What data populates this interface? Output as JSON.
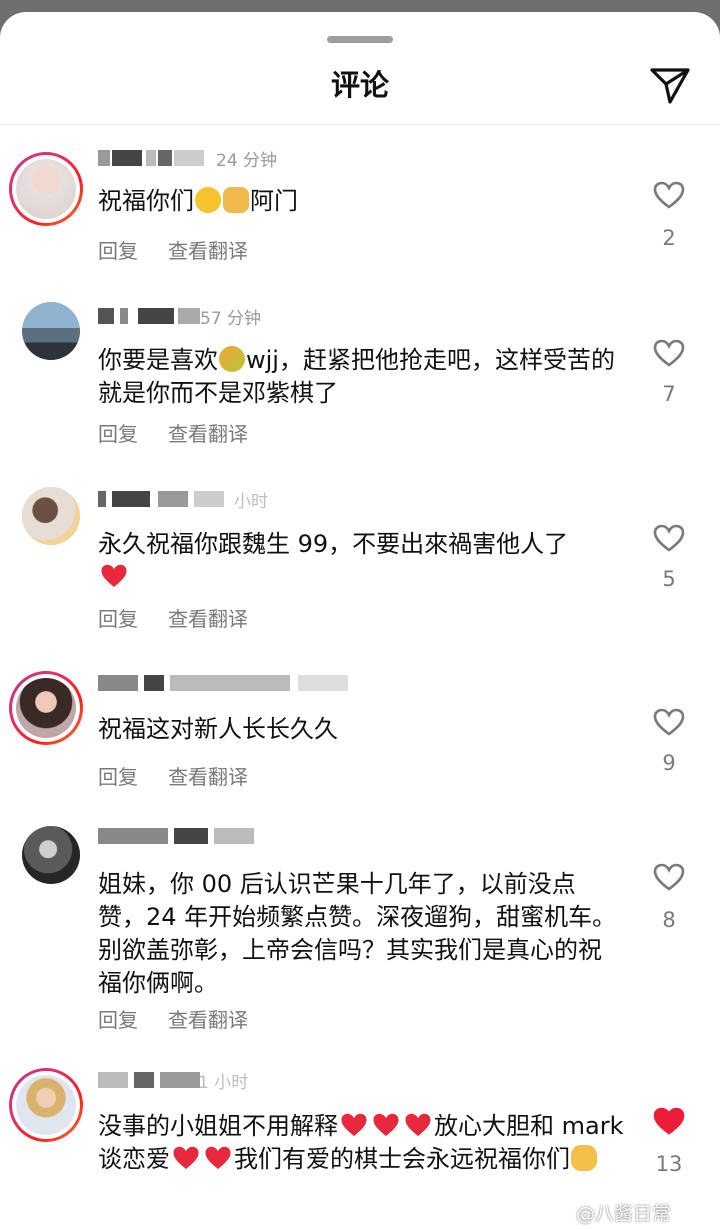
{
  "header": {
    "title": "评论"
  },
  "actions": {
    "reply": "回复",
    "translate": "查看翻译"
  },
  "comments": [
    {
      "meta": "24 分钟",
      "text_a": "祝福你们",
      "text_b": "阿门",
      "likes": "2",
      "liked": false,
      "avatar_icon": "avatar-woman"
    },
    {
      "meta": "57 分钟",
      "text_a": "你要是喜欢",
      "text_b": "wjj，赶紧把他抢走吧，这样受苦的就是你而不是邓紫棋了",
      "likes": "7",
      "liked": false,
      "avatar_icon": "avatar-man-city"
    },
    {
      "meta": "小时",
      "text_a": "永久祝福你跟魏生 99，不要出來禍害他人了",
      "likes": "5",
      "liked": false,
      "avatar_icon": "avatar-woman-flowers"
    },
    {
      "meta": "",
      "text_a": "祝福这对新人长长久久",
      "likes": "9",
      "liked": false,
      "avatar_icon": "avatar-woman-pink"
    },
    {
      "meta": "",
      "text_a": "姐妹，你 00 后认识芒果十几年了，以前没点赞，24 年开始频繁点赞。深夜遛狗，甜蜜机车。别欲盖弥彰，上帝会信吗？其实我们是真心的祝福你俩啊。",
      "likes": "8",
      "liked": false,
      "avatar_icon": "avatar-man-bw"
    },
    {
      "meta": "1 小时",
      "text_a": "没事的小姐姐不用解释",
      "text_b": "放心大胆和 mark 谈恋爱",
      "text_c": "我们有爱的棋士会永远祝福你们",
      "likes": "13",
      "liked": true,
      "avatar_icon": "avatar-girl-jersey"
    }
  ],
  "watermark": "@八酱日常",
  "colors": {
    "liked": "#ed1d3a",
    "secondary": "#7a7a7a"
  }
}
